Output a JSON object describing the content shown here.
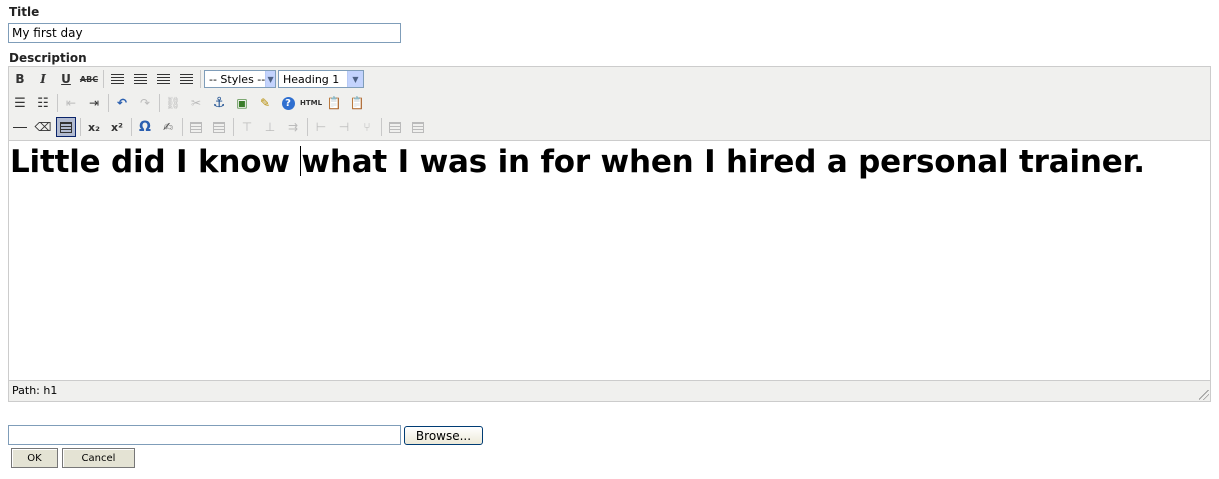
{
  "form": {
    "title_label": "Title",
    "title_value": "My first day",
    "description_label": "Description",
    "browse_label": "Browse...",
    "ok_label": "OK",
    "cancel_label": "Cancel",
    "file_value": ""
  },
  "toolbar": {
    "bold": "B",
    "italic": "I",
    "underline": "U",
    "strike": "ABC",
    "styles_value": "-- Styles --",
    "format_value": "Heading 1",
    "html": "HTML",
    "omega": "Ω",
    "sub": "x₂",
    "sup": "x²"
  },
  "editor": {
    "content_before_caret": "Little did I know ",
    "content_after_caret": "what I was in for when I hired a personal trainer.",
    "path": "Path: h1"
  },
  "colors": {
    "toolbar_bg": "#f0f0ee",
    "input_border": "#7f9db9",
    "button_bg": "#e4e3d4"
  }
}
